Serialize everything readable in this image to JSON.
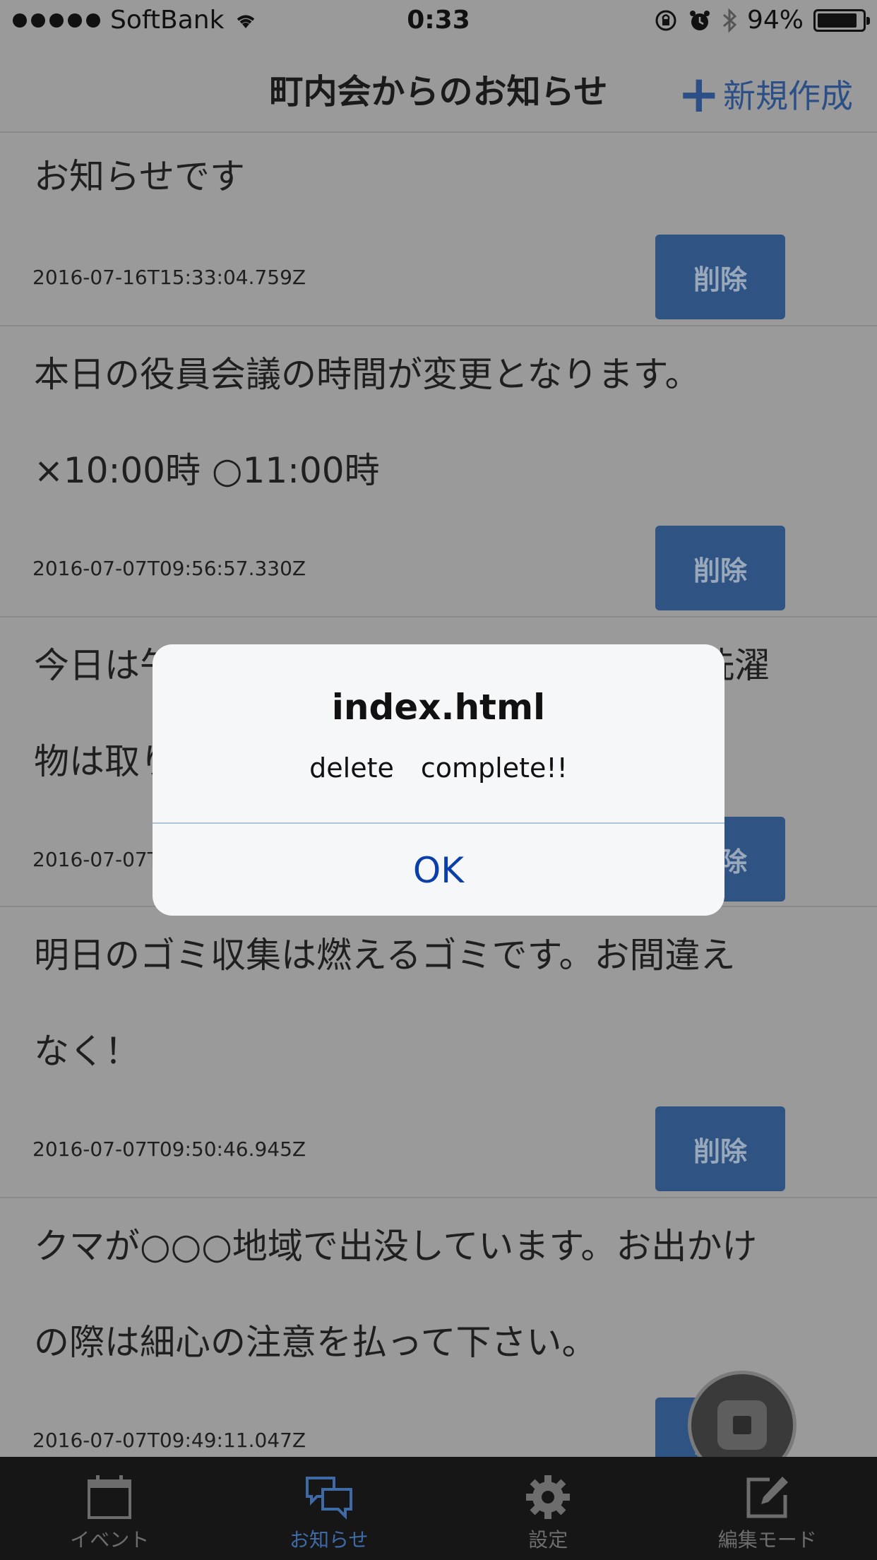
{
  "status_bar": {
    "carrier": "SoftBank",
    "time": "0:33",
    "battery": "94%"
  },
  "nav": {
    "title": "町内会からのお知らせ",
    "new_button": "新規作成"
  },
  "notices": [
    {
      "text": "お知らせです",
      "date": "2016-07-16T15:33:04.759Z",
      "delete_label": "削除"
    },
    {
      "text": "本日の役員会議の時間が変更となります。\n×10:00時 ○11:00時",
      "date": "2016-07-07T09:56:57.330Z",
      "delete_label": "削除"
    },
    {
      "text": "今日は午後から雨の予報です。干してある洗濯\n物は取り込んでください。",
      "date": "2016-07-07T09:53:12.158Z",
      "delete_label": "削除"
    },
    {
      "text": "明日のゴミ収集は燃えるゴミです。お間違え\nなく！",
      "date": "2016-07-07T09:50:46.945Z",
      "delete_label": "削除"
    },
    {
      "text": "クマが○○○地域で出没しています。お出かけ\nの際は細心の注意を払って下さい。",
      "date": "2016-07-07T09:49:11.047Z",
      "delete_label": "削除"
    }
  ],
  "dialog": {
    "title": "index.html",
    "message": "delete　complete!!",
    "ok_label": "OK"
  },
  "tabs": [
    {
      "label": "イベント",
      "icon": "calendar-icon",
      "active": false
    },
    {
      "label": "お知らせ",
      "icon": "chat-bubbles-icon",
      "active": true
    },
    {
      "label": "設定",
      "icon": "gear-icon",
      "active": false
    },
    {
      "label": "編集モード",
      "icon": "edit-icon",
      "active": false
    }
  ],
  "colors": {
    "accent": "#3e6aa6",
    "delete_button": "#2f5382",
    "dialog_ok": "#0a3ea8"
  }
}
